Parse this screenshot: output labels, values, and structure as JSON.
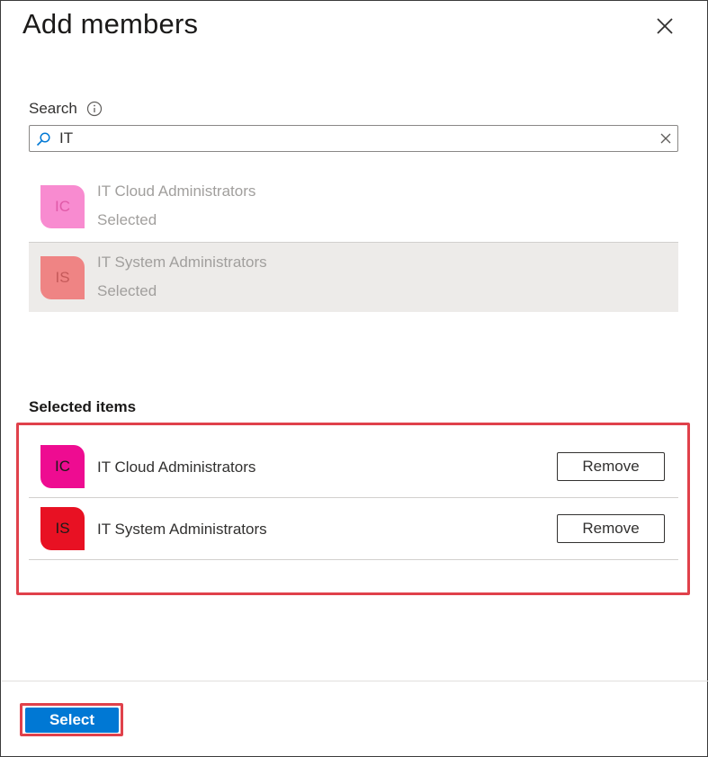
{
  "dialog": {
    "title": "Add members",
    "close_icon": "close-icon"
  },
  "search": {
    "label": "Search",
    "info_icon": "info-icon",
    "search_icon": "search-icon",
    "clear_icon": "clear-icon",
    "value": "IT",
    "placeholder": ""
  },
  "results": [
    {
      "initials": "IC",
      "name": "IT Cloud Administrators",
      "status": "Selected",
      "avatar_color": "#f88bd0",
      "initials_color": "#e05aa8",
      "highlighted": false
    },
    {
      "initials": "IS",
      "name": "IT System Administrators",
      "status": "Selected",
      "avatar_color": "#ef8484",
      "initials_color": "#c55a5a",
      "highlighted": true
    }
  ],
  "selected": {
    "heading": "Selected items",
    "items": [
      {
        "initials": "IC",
        "name": "IT Cloud Administrators",
        "remove_label": "Remove",
        "avatar_color": "#ee0c91"
      },
      {
        "initials": "IS",
        "name": "IT System Administrators",
        "remove_label": "Remove",
        "avatar_color": "#e81123"
      }
    ]
  },
  "footer": {
    "select_label": "Select"
  },
  "colors": {
    "accent": "#0078d4",
    "highlight_border": "#e0414b"
  }
}
